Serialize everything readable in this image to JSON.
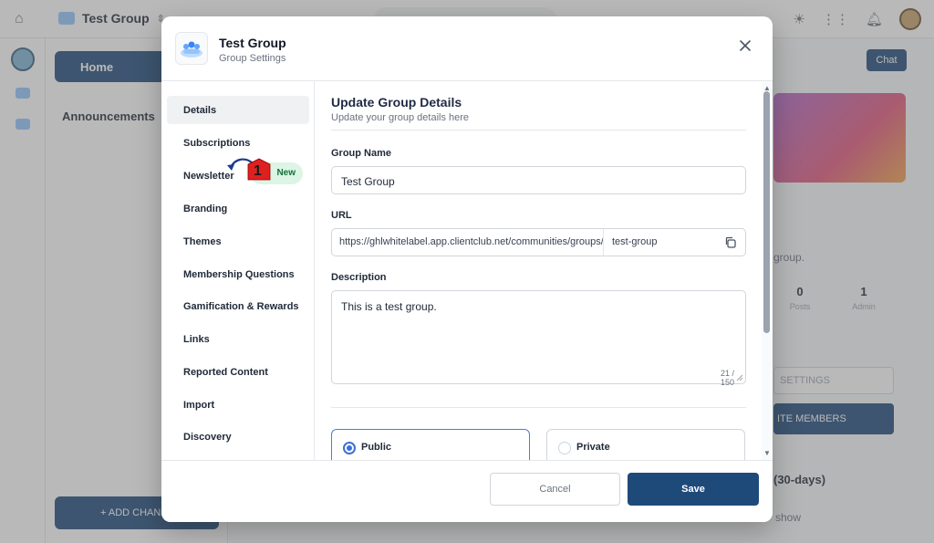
{
  "background": {
    "group_title": "Test Group",
    "home_label": "Home",
    "announcements_label": "Announcements",
    "add_channel_label": "+ ADD CHANN",
    "chat_label": "Chat",
    "group_text": "group.",
    "stats": [
      {
        "value": "0",
        "label": "Posts"
      },
      {
        "value": "1",
        "label": "Admin"
      }
    ],
    "settings_label": "SETTINGS",
    "invite_label": "ITE MEMBERS",
    "period_label": "(30-days)",
    "show_label": "show"
  },
  "modal": {
    "title": "Test Group",
    "subtitle": "Group Settings",
    "nav": [
      {
        "label": "Details",
        "active": true
      },
      {
        "label": "Subscriptions"
      },
      {
        "label": "Newsletter",
        "badge": "New"
      },
      {
        "label": "Branding"
      },
      {
        "label": "Themes"
      },
      {
        "label": "Membership Questions"
      },
      {
        "label": "Gamification & Rewards"
      },
      {
        "label": "Links"
      },
      {
        "label": "Reported Content"
      },
      {
        "label": "Import"
      },
      {
        "label": "Discovery"
      }
    ],
    "step_marker": "1",
    "section_title": "Update Group Details",
    "section_subtitle": "Update your group details here",
    "group_name": {
      "label": "Group Name",
      "value": "Test Group"
    },
    "url": {
      "label": "URL",
      "prefix": "https://ghlwhitelabel.app.clientclub.net/communities/groups/",
      "slug": "test-group"
    },
    "description": {
      "label": "Description",
      "value": "This is a test group.",
      "char_count": "21 / 150"
    },
    "privacy": {
      "options": [
        {
          "label": "Public",
          "selected": true
        },
        {
          "label": "Private",
          "selected": false
        }
      ]
    },
    "cancel_label": "Cancel",
    "save_label": "Save"
  },
  "colors": {
    "primary": "#1e4a7a",
    "badge_bg": "#dcf5e4",
    "badge_text": "#16703a",
    "marker_red": "#e02020",
    "radio_selected": "#3b6fd8"
  }
}
